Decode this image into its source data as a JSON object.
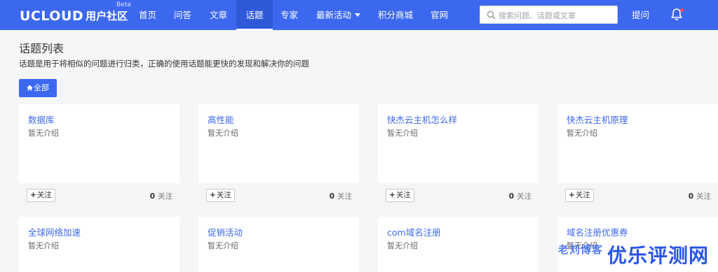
{
  "header": {
    "logo_brand": "UCLOUD",
    "logo_suffix": "用户社区",
    "logo_beta": "Beta",
    "nav": [
      {
        "label": "首页"
      },
      {
        "label": "问答"
      },
      {
        "label": "文章"
      },
      {
        "label": "话题",
        "active": true
      },
      {
        "label": "专家"
      },
      {
        "label": "最新活动",
        "dropdown": true
      },
      {
        "label": "积分商城"
      },
      {
        "label": "官网"
      }
    ],
    "search_placeholder": "搜索问题、话题或文章",
    "ask_label": "提问",
    "accent_color": "#3c68f0"
  },
  "page": {
    "title": "话题列表",
    "description": "话题是用于将相似的问题进行归类，正确的使用话题能更快的发现和解决你的问题",
    "all_button": "全部"
  },
  "topics": [
    {
      "title": "数据库",
      "desc": "暂无介绍",
      "follow_label": "关注",
      "count": "0",
      "count_label": "关注"
    },
    {
      "title": "高性能",
      "desc": "暂无介绍",
      "follow_label": "关注",
      "count": "0",
      "count_label": "关注"
    },
    {
      "title": "快杰云主机怎么样",
      "desc": "暂无介绍",
      "follow_label": "关注",
      "count": "0",
      "count_label": "关注"
    },
    {
      "title": "快杰云主机原理",
      "desc": "暂无介绍",
      "follow_label": "关注",
      "count": "0",
      "count_label": "关注"
    },
    {
      "title": "全球网络加速",
      "desc": "暂无介绍"
    },
    {
      "title": "促销活动",
      "desc": "暂无介绍"
    },
    {
      "title": "com域名注册",
      "desc": "暂无介绍"
    },
    {
      "title": "域名注册优惠券",
      "desc": "暂无介绍"
    }
  ],
  "watermark": {
    "small": "老刘博客",
    "large": "优乐评测网"
  }
}
